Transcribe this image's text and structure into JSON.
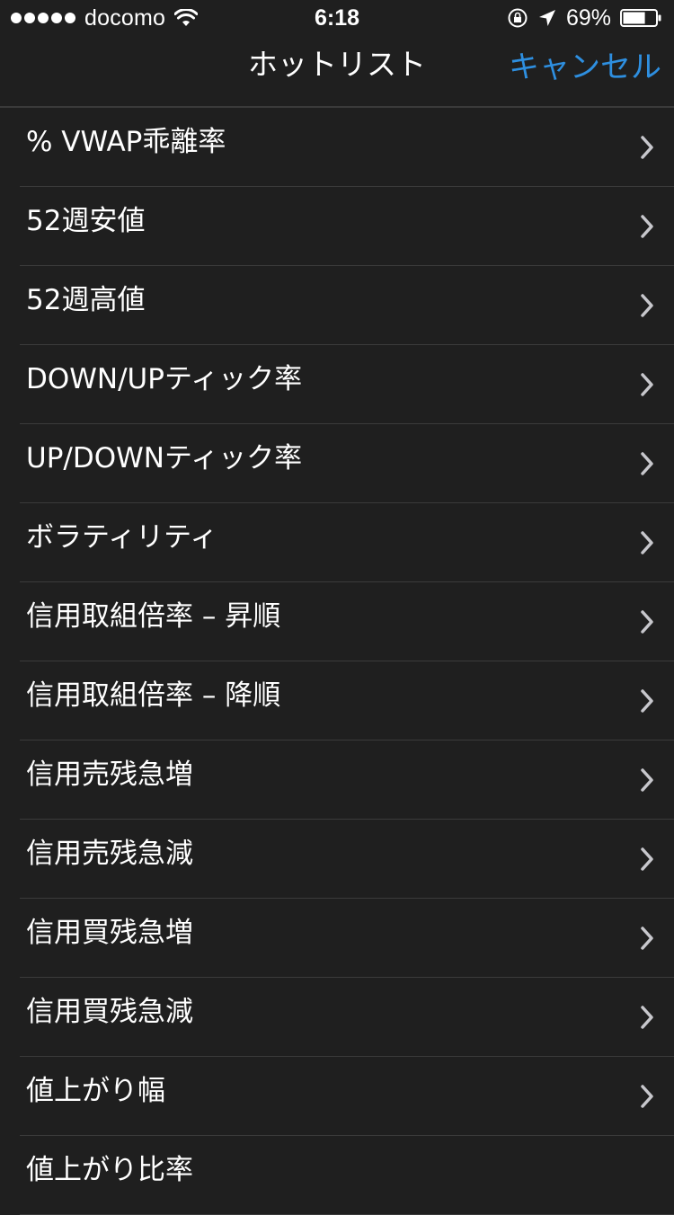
{
  "status_bar": {
    "carrier": "docomo",
    "time": "6:18",
    "battery_percent": "69%",
    "battery_level": 0.69,
    "icons": [
      "signal-dots-icon",
      "wifi-icon",
      "orientation-lock-icon",
      "location-arrow-icon",
      "battery-icon"
    ]
  },
  "nav": {
    "title": "ホットリスト",
    "cancel_label": "キャンセル",
    "accent_color": "#2e8fe0"
  },
  "list": {
    "items": [
      {
        "label": "% VWAP乖離率",
        "chevron": true
      },
      {
        "label": "52週安値",
        "chevron": true
      },
      {
        "label": "52週高値",
        "chevron": true
      },
      {
        "label": "DOWN/UPティック率",
        "chevron": true
      },
      {
        "label": "UP/DOWNティック率",
        "chevron": true
      },
      {
        "label": "ボラティリティ",
        "chevron": true
      },
      {
        "label": "信用取組倍率 – 昇順",
        "chevron": true
      },
      {
        "label": "信用取組倍率 – 降順",
        "chevron": true
      },
      {
        "label": "信用売残急増",
        "chevron": true
      },
      {
        "label": "信用売残急減",
        "chevron": true
      },
      {
        "label": "信用買残急増",
        "chevron": true
      },
      {
        "label": "信用買残急減",
        "chevron": true
      },
      {
        "label": "値上がり幅",
        "chevron": true
      },
      {
        "label": "値上がり比率",
        "chevron": false
      }
    ]
  }
}
